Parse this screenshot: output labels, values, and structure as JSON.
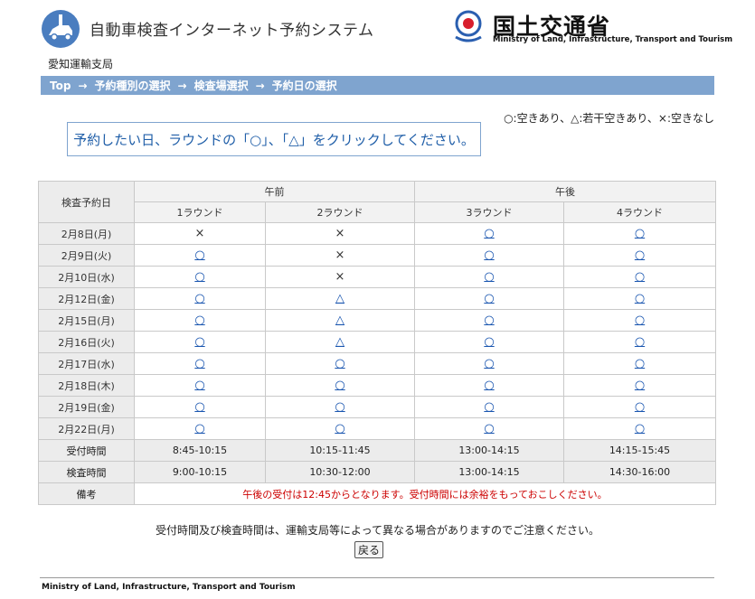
{
  "header": {
    "app_title": "自動車検査インターネット予約システム",
    "bureau": "愛知運輸支局",
    "ministry_jp": "国土交通省",
    "ministry_en": "Ministry of Land, Infrastructure, Transport and Tourism"
  },
  "breadcrumb": {
    "top": "Top",
    "step1": "予約種別の選択",
    "step2": "検査場選択",
    "step3": "予約日の選択",
    "arrow": "→"
  },
  "legend": "○:空きあり、△:若干空きあり、×:空きなし",
  "instruction": "予約したい日、ラウンドの「○」、「△」をクリックしてください。",
  "table": {
    "date_header": "検査予約日",
    "am": "午前",
    "pm": "午後",
    "rounds": [
      "1ラウンド",
      "2ラウンド",
      "3ラウンド",
      "4ラウンド"
    ],
    "rows": [
      {
        "date": "2月8日(月)",
        "slots": [
          "×",
          "×",
          "○",
          "○"
        ]
      },
      {
        "date": "2月9日(火)",
        "slots": [
          "○",
          "×",
          "○",
          "○"
        ]
      },
      {
        "date": "2月10日(水)",
        "slots": [
          "○",
          "×",
          "○",
          "○"
        ]
      },
      {
        "date": "2月12日(金)",
        "slots": [
          "○",
          "△",
          "○",
          "○"
        ]
      },
      {
        "date": "2月15日(月)",
        "slots": [
          "○",
          "△",
          "○",
          "○"
        ]
      },
      {
        "date": "2月16日(火)",
        "slots": [
          "○",
          "△",
          "○",
          "○"
        ]
      },
      {
        "date": "2月17日(水)",
        "slots": [
          "○",
          "○",
          "○",
          "○"
        ]
      },
      {
        "date": "2月18日(木)",
        "slots": [
          "○",
          "○",
          "○",
          "○"
        ]
      },
      {
        "date": "2月19日(金)",
        "slots": [
          "○",
          "○",
          "○",
          "○"
        ]
      },
      {
        "date": "2月22日(月)",
        "slots": [
          "○",
          "○",
          "○",
          "○"
        ]
      }
    ],
    "reception_label": "受付時間",
    "reception": [
      "8:45-10:15",
      "10:15-11:45",
      "13:00-14:15",
      "14:15-15:45"
    ],
    "inspection_label": "検査時間",
    "inspection": [
      "9:00-10:15",
      "10:30-12:00",
      "13:00-14:15",
      "14:30-16:00"
    ],
    "note_label": "備考",
    "note": "午後の受付は12:45からとなります。受付時間には余裕をもっておこしください。"
  },
  "caution": "受付時間及び検査時間は、運輸支局等によって異なる場合がありますのでご注意ください。",
  "back_label": "戻る",
  "footer": "Ministry of Land, Infrastructure, Transport and Tourism",
  "colors": {
    "breadcrumb_bg": "#7fa4cf",
    "link": "#1a56b0",
    "note": "#cc0000",
    "logo_blue": "#4a7dbf"
  }
}
